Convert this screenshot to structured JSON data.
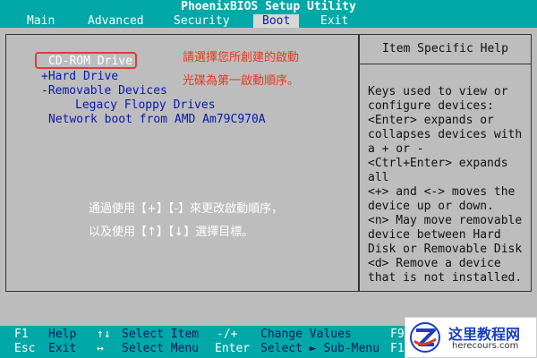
{
  "title": "PhoenixBIOS Setup Utility",
  "menu": [
    {
      "label": "Main",
      "active": false
    },
    {
      "label": "Advanced",
      "active": false
    },
    {
      "label": "Security",
      "active": false
    },
    {
      "label": "Boot",
      "active": true
    },
    {
      "label": "Exit",
      "active": false
    }
  ],
  "boot_items": [
    {
      "label": "CD-ROM Drive",
      "selected": true
    },
    {
      "label": "+Hard Drive",
      "selected": false
    },
    {
      "label": "-Removable Devices",
      "selected": false
    },
    {
      "label": "Legacy Floppy Drives",
      "selected": false
    },
    {
      "label": "Network boot from AMD Am79C970A",
      "selected": false
    }
  ],
  "annotations": {
    "top_line1": "請選擇您所創建的啟動",
    "top_line2": "光碟為第一啟動順序。",
    "mid_line1": "通過使用【+】【-】來更改啟動順序，",
    "mid_line2": "以及使用【↑】【↓】選擇目標。"
  },
  "help": {
    "title": "Item Specific Help",
    "lines": [
      "Keys used to view or",
      "configure devices:",
      "<Enter> expands or",
      "collapses devices with",
      "a + or -",
      "<Ctrl+Enter> expands",
      "all",
      "<+> and <-> moves the",
      "device up or down.",
      "<n> May move removable",
      "device between Hard",
      "Disk or Removable Disk",
      "<d> Remove a device",
      "that is not installed."
    ]
  },
  "keys": {
    "row1": [
      {
        "key": "F1",
        "desc": "Help"
      },
      {
        "key": "↑↓",
        "desc": "Select Item"
      },
      {
        "key": "-/+",
        "desc": "Change Values"
      },
      {
        "key": "F9",
        "desc": ""
      }
    ],
    "row2": [
      {
        "key": "Esc",
        "desc": "Exit"
      },
      {
        "key": "↔",
        "desc": "Select Menu"
      },
      {
        "key": "Enter",
        "desc": "Select ► Sub-Menu"
      },
      {
        "key": "F10",
        "desc": ""
      }
    ]
  },
  "watermark": {
    "name": "这里教程网",
    "url": "herecours.com"
  },
  "colors": {
    "bar": "#00a8a8",
    "panel": "#bdbdbd",
    "text_blue": "#0a18a8",
    "annotation_red": "#e53a1f"
  }
}
